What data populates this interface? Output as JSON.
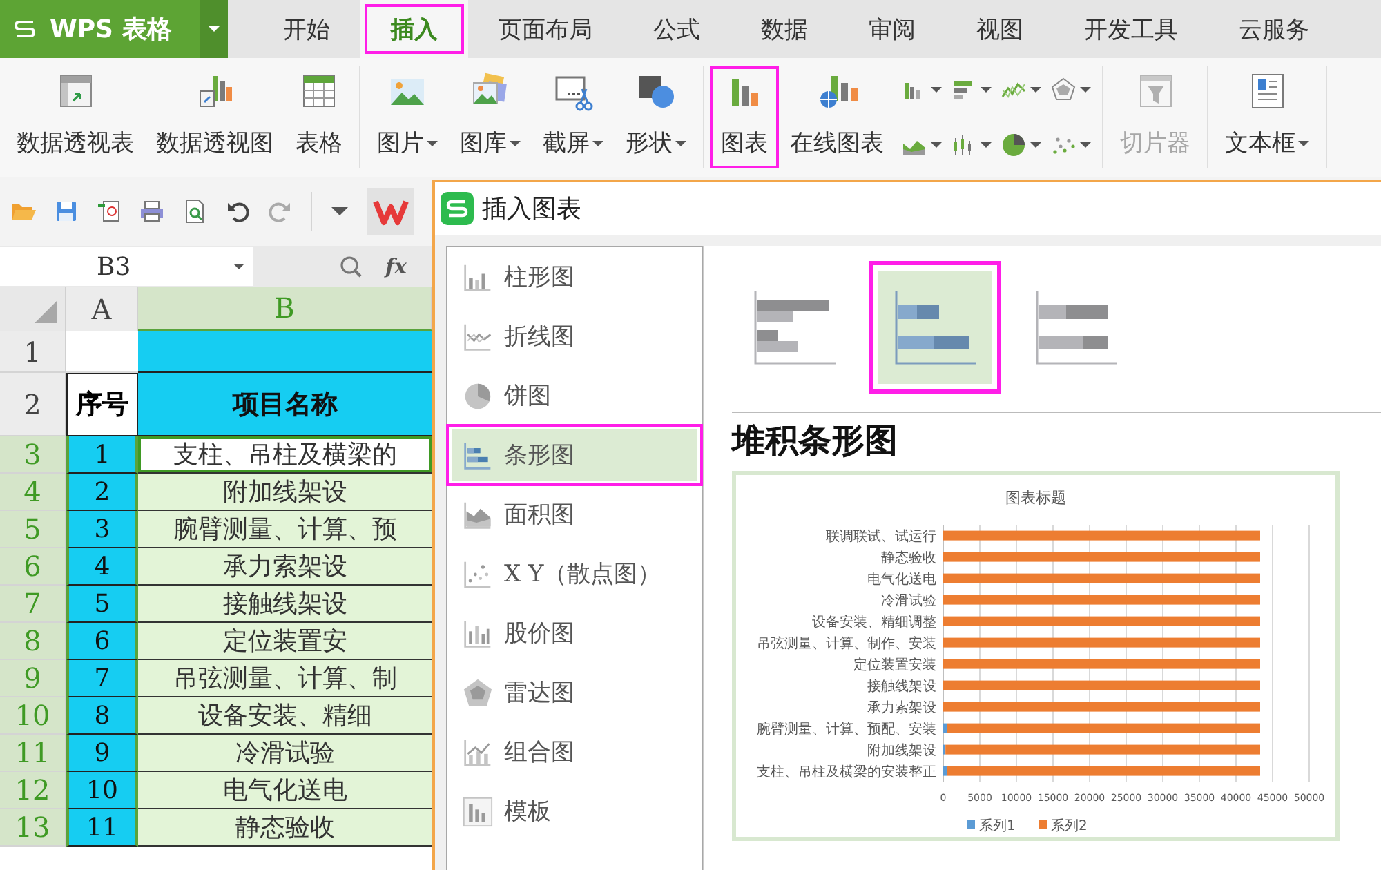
{
  "app_menu": {
    "label": "WPS 表格"
  },
  "tabs": [
    {
      "label": "开始",
      "selected": false,
      "highlighted": false
    },
    {
      "label": "插入",
      "selected": true,
      "highlighted": true
    },
    {
      "label": "页面布局",
      "selected": false,
      "highlighted": false
    },
    {
      "label": "公式",
      "selected": false,
      "highlighted": false
    },
    {
      "label": "数据",
      "selected": false,
      "highlighted": false
    },
    {
      "label": "审阅",
      "selected": false,
      "highlighted": false
    },
    {
      "label": "视图",
      "selected": false,
      "highlighted": false
    },
    {
      "label": "开发工具",
      "selected": false,
      "highlighted": false
    },
    {
      "label": "云服务",
      "selected": false,
      "highlighted": false
    }
  ],
  "ribbon_groups": [
    {
      "items": [
        {
          "label": "数据透视表",
          "dropdown": false,
          "disabled": false,
          "highlighted": false
        },
        {
          "label": "数据透视图",
          "dropdown": false,
          "disabled": false,
          "highlighted": false
        },
        {
          "label": "表格",
          "dropdown": false,
          "disabled": false,
          "highlighted": false
        }
      ]
    },
    {
      "items": [
        {
          "label": "图片",
          "dropdown": true,
          "disabled": false,
          "highlighted": false
        },
        {
          "label": "图库",
          "dropdown": true,
          "disabled": false,
          "highlighted": false
        },
        {
          "label": "截屏",
          "dropdown": true,
          "disabled": false,
          "highlighted": false
        },
        {
          "label": "形状",
          "dropdown": true,
          "disabled": false,
          "highlighted": false
        }
      ]
    },
    {
      "items": [
        {
          "label": "图表",
          "dropdown": false,
          "disabled": false,
          "highlighted": true
        },
        {
          "label": "在线图表",
          "dropdown": false,
          "disabled": false,
          "highlighted": false
        }
      ],
      "shortcuts": [
        {
          "dropdown": true
        },
        {
          "dropdown": true
        },
        {
          "dropdown": true
        },
        {
          "dropdown": true
        },
        {
          "dropdown": true
        },
        {
          "dropdown": true
        },
        {
          "dropdown": true
        },
        {
          "dropdown": true
        }
      ]
    },
    {
      "items": [
        {
          "label": "切片器",
          "dropdown": false,
          "disabled": true,
          "highlighted": false
        }
      ]
    },
    {
      "items": [
        {
          "label": "文本框",
          "dropdown": true,
          "disabled": false,
          "highlighted": false
        }
      ]
    }
  ],
  "name_box": {
    "value": "B3"
  },
  "formula_bar": {
    "function_label": "fx"
  },
  "sheet": {
    "columns": [
      {
        "label": "A",
        "highlighted": false
      },
      {
        "label": "B",
        "highlighted": true
      }
    ],
    "rows": [
      {
        "number": "1",
        "kind": "title",
        "in_selection": false,
        "selected": false
      },
      {
        "number": "2",
        "kind": "header",
        "seq": "序号",
        "name": "项目名称",
        "in_selection": false,
        "selected": false
      },
      {
        "number": "3",
        "kind": "data",
        "seq": "1",
        "name": "支柱、吊柱及横梁的",
        "in_selection": true,
        "selected": true
      },
      {
        "number": "4",
        "kind": "data",
        "seq": "2",
        "name": "附加线架设",
        "in_selection": true,
        "selected": false
      },
      {
        "number": "5",
        "kind": "data",
        "seq": "3",
        "name": "腕臂测量、计算、预",
        "in_selection": true,
        "selected": false
      },
      {
        "number": "6",
        "kind": "data",
        "seq": "4",
        "name": "承力索架设",
        "in_selection": true,
        "selected": false
      },
      {
        "number": "7",
        "kind": "data",
        "seq": "5",
        "name": "接触线架设",
        "in_selection": true,
        "selected": false
      },
      {
        "number": "8",
        "kind": "data",
        "seq": "6",
        "name": "定位装置安",
        "in_selection": true,
        "selected": false
      },
      {
        "number": "9",
        "kind": "data",
        "seq": "7",
        "name": "吊弦测量、计算、制",
        "in_selection": true,
        "selected": false
      },
      {
        "number": "10",
        "kind": "data",
        "seq": "8",
        "name": "设备安装、精细",
        "in_selection": true,
        "selected": false
      },
      {
        "number": "11",
        "kind": "data",
        "seq": "9",
        "name": "冷滑试验",
        "in_selection": true,
        "selected": false
      },
      {
        "number": "12",
        "kind": "data",
        "seq": "10",
        "name": "电气化送电",
        "in_selection": true,
        "selected": false
      },
      {
        "number": "13",
        "kind": "data",
        "seq": "11",
        "name": "静态验收",
        "in_selection": true,
        "selected": false
      }
    ]
  },
  "dialog": {
    "title": "插入图表",
    "categories": [
      {
        "label": "柱形图",
        "selected": false,
        "highlighted": false
      },
      {
        "label": "折线图",
        "selected": false,
        "highlighted": false
      },
      {
        "label": "饼图",
        "selected": false,
        "highlighted": false
      },
      {
        "label": "条形图",
        "selected": true,
        "highlighted": true
      },
      {
        "label": "面积图",
        "selected": false,
        "highlighted": false
      },
      {
        "label": "X Y（散点图）",
        "selected": false,
        "highlighted": false
      },
      {
        "label": "股价图",
        "selected": false,
        "highlighted": false
      },
      {
        "label": "雷达图",
        "selected": false,
        "highlighted": false
      },
      {
        "label": "组合图",
        "selected": false,
        "highlighted": false
      },
      {
        "label": "模板",
        "selected": false,
        "highlighted": false
      }
    ],
    "subtypes": [
      {
        "selected": false,
        "highlighted": false
      },
      {
        "selected": true,
        "highlighted": true
      },
      {
        "selected": false,
        "highlighted": false
      }
    ],
    "subtype_title": "堆积条形图",
    "preview": {
      "chart_data": {
        "type": "bar",
        "orientation": "horizontal",
        "stacked": true,
        "title": "图表标题",
        "categories": [
          "联调联试、试运行",
          "静态验收",
          "电气化送电",
          "冷滑试验",
          "设备安装、精细调整",
          "吊弦测量、计算、制作、安装",
          "定位装置安装",
          "接触线架设",
          "承力索架设",
          "腕臂测量、计算、预配、安装",
          "附加线架设",
          "支柱、吊柱及横梁的安装整正"
        ],
        "series": [
          {
            "name": "系列1",
            "color": "#5b9bd5",
            "values": [
              0,
              0,
              0,
              0,
              0,
              0,
              0,
              0,
              0,
              500,
              300,
              500
            ]
          },
          {
            "name": "系列2",
            "color": "#ed7d31",
            "values": [
              43300,
              43300,
              43300,
              43300,
              43300,
              43300,
              43300,
              43300,
              43300,
              42800,
              43000,
              42800
            ]
          }
        ],
        "grid": true,
        "legend": true,
        "xlim": [
          0,
          50000
        ],
        "xticks": [
          0,
          5000,
          10000,
          15000,
          20000,
          25000,
          30000,
          35000,
          40000,
          45000,
          50000
        ]
      }
    }
  }
}
